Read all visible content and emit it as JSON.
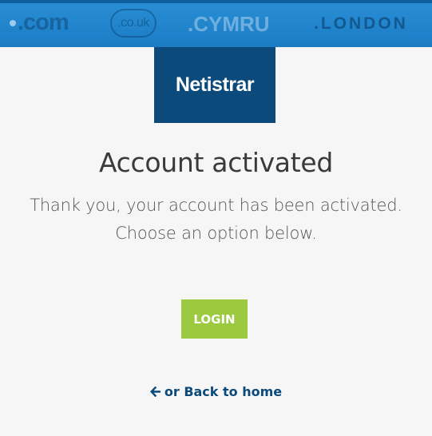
{
  "banner": {
    "tlds": [
      ".com",
      ".co.uk",
      ".CYMRU",
      ".LONDON"
    ]
  },
  "logo": {
    "text": "Netistrar"
  },
  "main": {
    "title": "Account activated",
    "message_line1": "Thank you, your account has been activated.",
    "message_line2": "Choose an option below.",
    "login_label": "LOGIN",
    "back_label": "or Back to home",
    "back_icon": "arrow-left-icon"
  },
  "colors": {
    "banner": "#1b7cc4",
    "logo_bg": "#0b4a7a",
    "login_bg": "#9bc93f",
    "link": "#0b4a7a",
    "page_bg": "#f6f6f6"
  }
}
